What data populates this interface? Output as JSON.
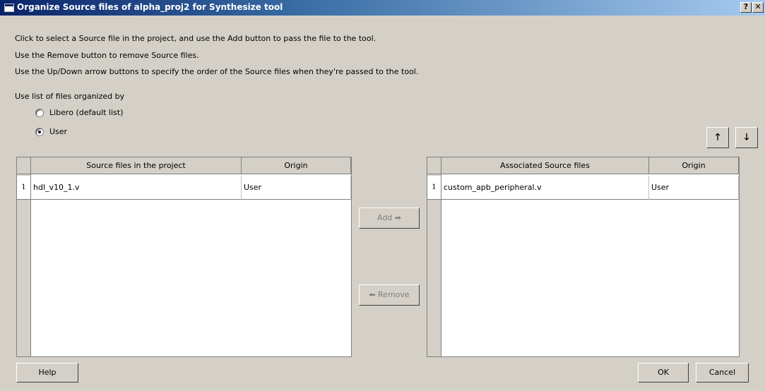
{
  "window": {
    "title": "Organize Source files of alpha_proj2 for Synthesize tool",
    "help_glyph": "?",
    "close_glyph": "✕"
  },
  "instructions": [
    "Click to select a Source file in the project, and use the Add button to pass the file to the tool.",
    "Use the Remove button to remove Source files.",
    "Use the Up/Down arrow buttons to specify the order of the Source files when they're passed to the tool."
  ],
  "organize": {
    "label": "Use list of files organized by",
    "options": [
      {
        "label": "Libero (default list)",
        "checked": false
      },
      {
        "label": "User",
        "checked": true
      }
    ]
  },
  "order_buttons": {
    "up": "🡑",
    "down": "🡓"
  },
  "left_table": {
    "columns": [
      "Source files in the project",
      "Origin"
    ],
    "rows": [
      {
        "num": "1",
        "file": "hdl_v10_1.v",
        "origin": "User"
      }
    ]
  },
  "right_table": {
    "columns": [
      "Associated Source files",
      "Origin"
    ],
    "rows": [
      {
        "num": "1",
        "file": "custom_apb_peripheral.v",
        "origin": "User"
      }
    ]
  },
  "transfer": {
    "add_label": "Add ➡",
    "remove_label": "⬅ Remove"
  },
  "footer": {
    "help_label": "Help",
    "ok_label": "OK",
    "cancel_label": "Cancel"
  }
}
